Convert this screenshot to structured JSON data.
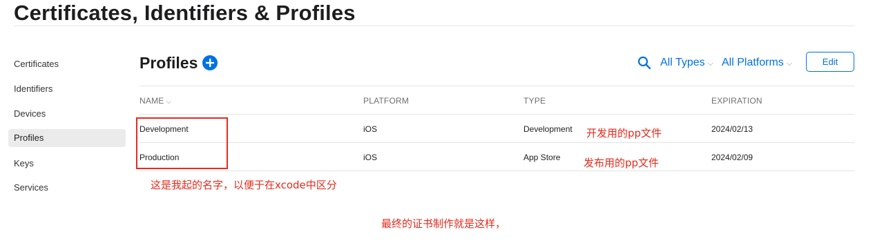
{
  "page_title": "Certificates, Identifiers & Profiles",
  "sidebar": {
    "items": [
      {
        "label": "Certificates",
        "active": false
      },
      {
        "label": "Identifiers",
        "active": false
      },
      {
        "label": "Devices",
        "active": false
      },
      {
        "label": "Profiles",
        "active": true
      },
      {
        "label": "Keys",
        "active": false
      },
      {
        "label": "Services",
        "active": false
      }
    ]
  },
  "main": {
    "title": "Profiles",
    "add_icon": "plus-circle-icon",
    "search_icon": "search-icon",
    "filters": {
      "types": "All Types",
      "platforms": "All Platforms"
    },
    "edit_label": "Edit",
    "table": {
      "headers": [
        "NAME",
        "PLATFORM",
        "TYPE",
        "EXPIRATION"
      ],
      "rows": [
        {
          "name": "Development",
          "platform": "iOS",
          "type": "Development",
          "expiration": "2024/02/13"
        },
        {
          "name": "Production",
          "platform": "iOS",
          "type": "App Store",
          "expiration": "2024/02/09"
        }
      ]
    }
  },
  "annotations": {
    "dev_note": "开发用的pp文件",
    "prod_note": "发布用的pp文件",
    "name_note": "这是我起的名字，以便于在xcode中区分",
    "footer_note": "最终的证书制作就是这样，"
  },
  "colors": {
    "accent": "#0071e3",
    "annotation": "#e8291b"
  }
}
